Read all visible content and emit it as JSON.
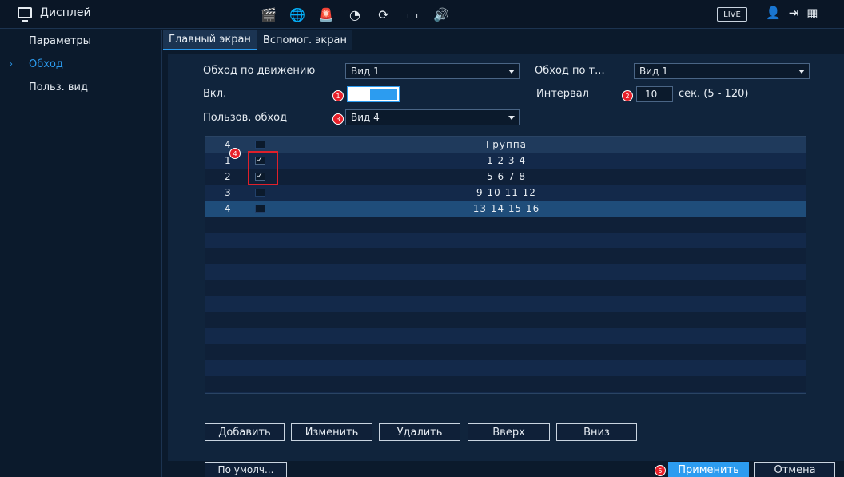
{
  "topbar": {
    "title": "Дисплей",
    "icons": [
      "clapperboard-icon",
      "globe-icon",
      "alarm-icon",
      "speed-gauge-icon",
      "refresh-circle-icon",
      "monitor-icon",
      "speaker-icon"
    ],
    "live_label": "LIVE",
    "right_icons": [
      "user-icon",
      "logout-icon",
      "qr-code-icon"
    ]
  },
  "sidebar": {
    "items": [
      {
        "label": "Параметры",
        "active": false
      },
      {
        "label": "Обход",
        "active": true
      },
      {
        "label": "Польз. вид",
        "active": false
      }
    ]
  },
  "tabs": [
    {
      "label": "Главный экран",
      "active": true
    },
    {
      "label": "Вспомог. экран",
      "active": false
    }
  ],
  "form": {
    "motion_tour_label": "Обход по движению",
    "motion_tour_value": "Вид 1",
    "alarm_tour_label": "Обход по т...",
    "alarm_tour_value": "Вид 1",
    "enable_label": "Вкл.",
    "enable_on": true,
    "interval_label": "Интервал",
    "interval_value": "10",
    "interval_unit": "сек. (5 - 120)",
    "user_tour_label": "Пользов. обход",
    "user_tour_value": "Вид 4"
  },
  "markers": [
    "1",
    "2",
    "3",
    "4",
    "5"
  ],
  "table": {
    "header": {
      "num": "4",
      "group": "Группа"
    },
    "rows": [
      {
        "num": "1",
        "checked": true,
        "group": "1 2 3 4"
      },
      {
        "num": "2",
        "checked": true,
        "group": "5 6 7 8"
      },
      {
        "num": "3",
        "checked": false,
        "group": "9 10 11 12"
      },
      {
        "num": "4",
        "checked": false,
        "group": "13 14 15 16"
      }
    ]
  },
  "buttons": {
    "add": "Добавить",
    "edit": "Изменить",
    "delete": "Удалить",
    "up": "Вверх",
    "down": "Вниз",
    "default": "По умолч...",
    "apply": "Применить",
    "cancel": "Отмена"
  },
  "colors": {
    "accent": "#2c9cf0",
    "background": "#0b1a2c",
    "marker": "#e8202a"
  }
}
